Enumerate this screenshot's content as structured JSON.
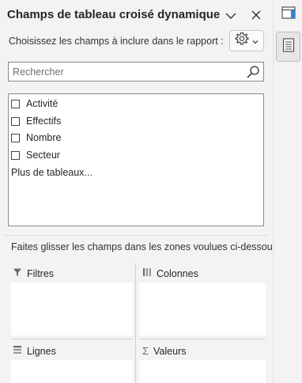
{
  "header": {
    "title": "Champs de tableau croisé dynamique"
  },
  "subtitle": "Choisissez les champs à inclure dans le rapport :",
  "search": {
    "placeholder": "Rechercher"
  },
  "fields": [
    {
      "label": "Activité",
      "checked": false
    },
    {
      "label": "Effectifs",
      "checked": false
    },
    {
      "label": "Nombre",
      "checked": false
    },
    {
      "label": "Secteur",
      "checked": false
    }
  ],
  "more_tables": "Plus de tableaux...",
  "instruction": "Faites glisser les champs dans les zones voulues ci-dessous:",
  "areas": {
    "filters": "Filtres",
    "columns": "Colonnes",
    "rows": "Lignes",
    "values": "Valeurs"
  },
  "icons": {
    "dropdown": "chevron-down-icon",
    "close": "close-icon",
    "settings": "gear-icon",
    "search": "search-icon",
    "filter": "filter-icon",
    "columns": "columns-icon",
    "rows": "rows-icon",
    "values": "sigma-icon",
    "rail_top": "pane-layout-icon",
    "rail_active": "field-list-icon"
  }
}
